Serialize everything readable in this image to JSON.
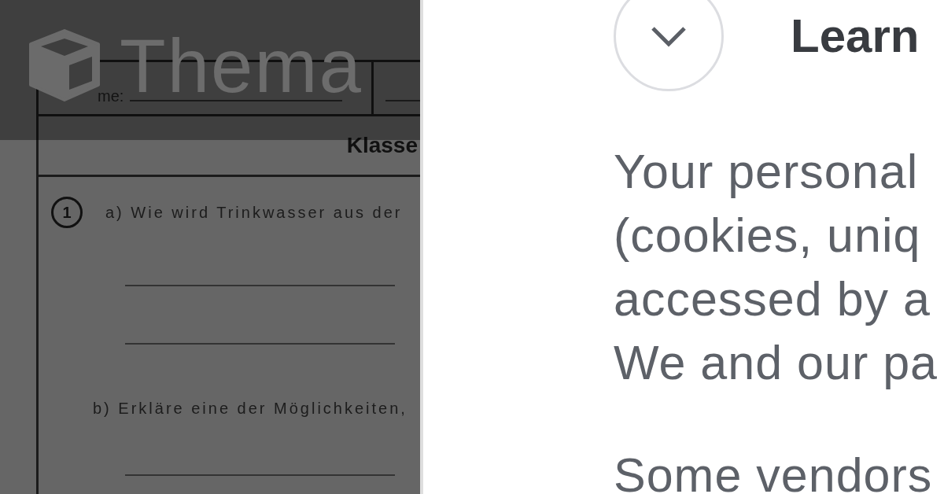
{
  "site_header": {
    "logo_text": "Thema"
  },
  "worksheet": {
    "name_label": "me:",
    "class_label": "Klasse",
    "task_number": "1",
    "items": [
      {
        "kind": "prompt",
        "text": "a) Wie wird Trinkwasser aus der"
      },
      {
        "kind": "answer_line"
      },
      {
        "kind": "answer_line"
      },
      {
        "kind": "prompt",
        "text": "b) Erkläre eine der Möglichkeiten,"
      },
      {
        "kind": "answer_line"
      }
    ]
  },
  "consent_panel": {
    "heading": "Learn",
    "paragraphs": [
      {
        "lines": [
          "Your personal",
          "(cookies, uniq",
          "accessed by a",
          "We and our pa"
        ]
      },
      {
        "lines": [
          "Some vendors"
        ]
      }
    ]
  }
}
